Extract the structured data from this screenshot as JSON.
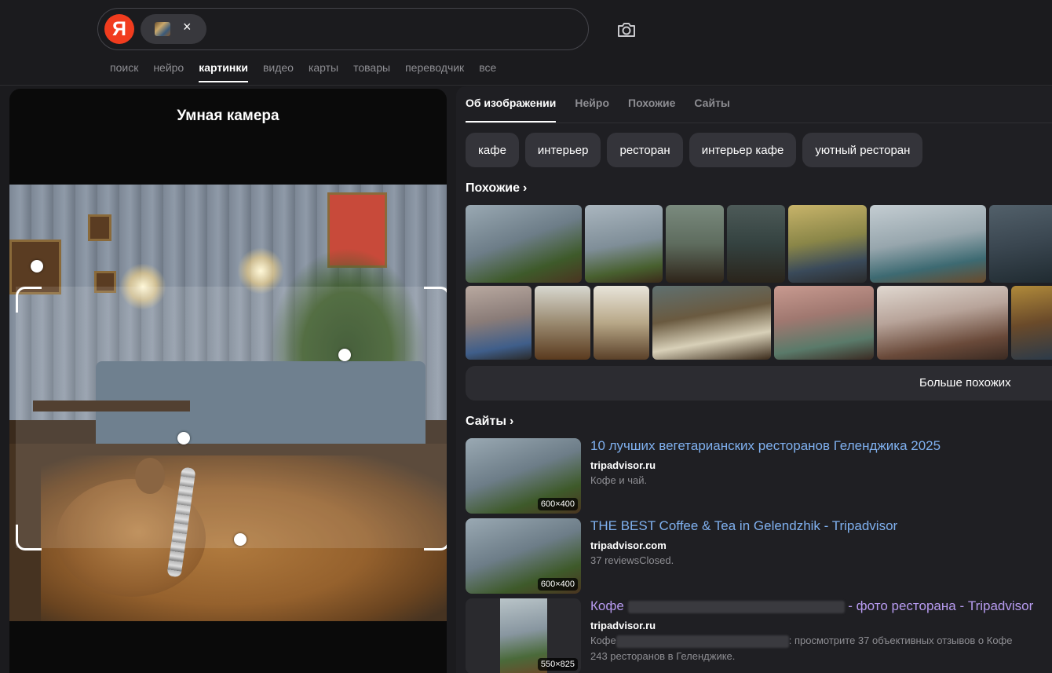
{
  "header": {
    "logo_letter": "Я",
    "chip_close": "×",
    "nav": [
      "поиск",
      "нейро",
      "картинки",
      "видео",
      "карты",
      "товары",
      "переводчик",
      "все"
    ],
    "nav_active": "картинки"
  },
  "left_panel": {
    "title": "Умная камера"
  },
  "right_panel": {
    "tabs": [
      "Об изображении",
      "Нейро",
      "Похожие",
      "Сайты"
    ],
    "active_tab": "Об изображении",
    "tags": [
      "кафе",
      "интерьер",
      "ресторан",
      "интерьер кафе",
      "уютный ресторан"
    ],
    "similar_title": "Похожие",
    "more_similar": "Больше похожих",
    "sites_title": "Сайты",
    "sites": [
      {
        "title": "10 лучших вегетарианских ресторанов Геленджика 2025",
        "domain": "tripadvisor.ru",
        "desc": "Кофе и чай.",
        "size": "600×400"
      },
      {
        "title": "THE BEST Coffee & Tea in Gelendzhik - Tripadvisor",
        "domain": "tripadvisor.com",
        "desc": "37 reviewsClosed.",
        "size": "600×400"
      },
      {
        "title_prefix": "Кофе",
        "title_suffix": "- фото ресторана - Tripadvisor",
        "domain": "tripadvisor.ru",
        "desc_prefix": "Кофе",
        "desc_suffix": ": просмотрите 37 объективных отзывов о Кофе",
        "desc_line2": "243 ресторанов в Геленджике.",
        "size": "550×825"
      }
    ]
  },
  "colors": {
    "background": "#1b1b1e",
    "panel": "#1f1f23",
    "logo": "#f13c1e",
    "link": "#7fb0ef",
    "visited_link": "#b79bf0",
    "muted": "#8e8e93"
  },
  "icons": [
    "yandex-logo",
    "image-chip-thumb",
    "close-icon",
    "camera-search-icon",
    "chevron-right-icon"
  ]
}
